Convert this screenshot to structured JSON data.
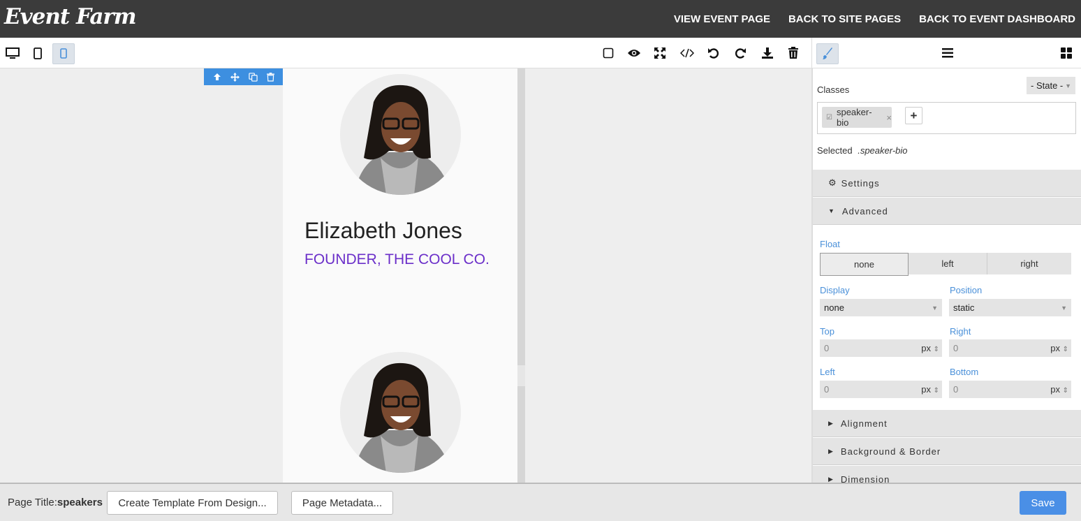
{
  "app": {
    "logo": "Event Farm"
  },
  "topnav": {
    "view_event_page": "VIEW EVENT PAGE",
    "back_to_site_pages": "BACK TO SITE PAGES",
    "back_to_event_dashboard": "BACK TO EVENT DASHBOARD"
  },
  "toolbar": {
    "devices": [
      {
        "icon": "desktop-icon"
      },
      {
        "icon": "tablet-icon"
      },
      {
        "icon": "mobile-icon",
        "active": true
      }
    ],
    "actions": [
      "square-outline-icon",
      "eye-icon",
      "fullscreen-icon",
      "code-icon",
      "undo-icon",
      "redo-icon",
      "download-icon",
      "trash-icon"
    ]
  },
  "canvas": {
    "speaker": {
      "name": "Elizabeth Jones",
      "title": "FOUNDER, THE COOL CO."
    }
  },
  "right_panel": {
    "toolbar": [
      "brush-icon",
      "hamburger-icon",
      "grid-icon"
    ],
    "classes_label": "Classes",
    "state_select": "- State -",
    "class_tag": "speaker-bio",
    "class_tag_remove": "×",
    "add_class": "+",
    "selected_label": "Selected",
    "selected_value": ".speaker-bio",
    "sections": {
      "settings": "Settings",
      "advanced": "Advanced",
      "alignment": "Alignment",
      "background_border": "Background & Border",
      "dimension": "Dimension"
    },
    "float": {
      "label": "Float",
      "options": [
        "none",
        "left",
        "right"
      ],
      "selected": "none"
    },
    "display": {
      "label": "Display",
      "value": "none"
    },
    "position": {
      "label": "Position",
      "value": "static"
    },
    "top": {
      "label": "Top",
      "value": "0",
      "unit": "px"
    },
    "right": {
      "label": "Right",
      "value": "0",
      "unit": "px"
    },
    "left": {
      "label": "Left",
      "value": "0",
      "unit": "px"
    },
    "bottom": {
      "label": "Bottom",
      "value": "0",
      "unit": "px"
    }
  },
  "bottombar": {
    "page_title_label": "Page Title:",
    "page_title_value": "speakers",
    "create_template": "Create Template From Design...",
    "page_metadata": "Page Metadata...",
    "save": "Save"
  },
  "colors": {
    "accent": "#4a8fe6",
    "title_purple": "#6b2fc9",
    "topbar": "#3b3b3b"
  }
}
